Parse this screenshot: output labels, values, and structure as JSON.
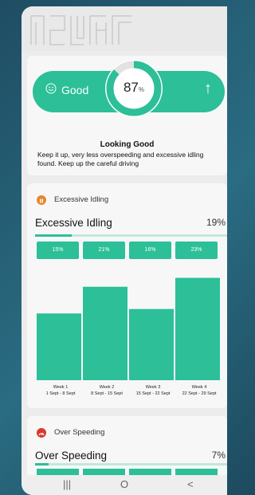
{
  "score_card": {
    "rating_label": "Good",
    "score_value": "87",
    "score_unit": "%",
    "score_fraction": 0.87,
    "status_title": "Looking Good",
    "status_description": "Keep it up, very less overspeeding and excessive idling found. Keep up the careful driving"
  },
  "idling": {
    "section_label": "Excessive Idling",
    "title": "Excessive Idling",
    "percent": "19%",
    "fraction": 0.19,
    "chips": [
      "15%",
      "21%",
      "16%",
      "23%"
    ],
    "icon": "pause-icon",
    "color": "#2cbf98"
  },
  "speeding": {
    "section_label": "Over Speeding",
    "title": "Over Speeding",
    "percent": "7%",
    "fraction": 0.07,
    "icon": "speedometer-icon",
    "color": "#d63b2f"
  },
  "chart_data": {
    "type": "bar",
    "categories": [
      "Week 1",
      "Week 2",
      "Week 3",
      "Week 4"
    ],
    "date_ranges": [
      "1 Sept - 8 Sept",
      "8 Sept - 15 Sept",
      "15 Sept - 22 Sept",
      "22 Sept - 29 Sept"
    ],
    "values": [
      15,
      21,
      16,
      23
    ],
    "ylim": [
      0,
      24
    ],
    "grid": false,
    "color": "#2cbf98"
  },
  "navbar": {
    "recent": "|||",
    "home": "O",
    "back": "<"
  }
}
